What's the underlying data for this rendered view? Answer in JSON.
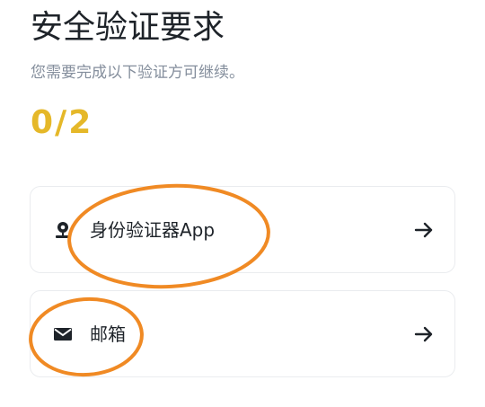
{
  "header": {
    "title": "安全验证要求",
    "subtitle": "您需要完成以下验证方可继续。"
  },
  "progress": {
    "text": "0/2",
    "completed": 0,
    "total": 2,
    "color": "#e5b829"
  },
  "methods": [
    {
      "label": "身份验证器App",
      "icon": "authenticator-icon",
      "arrow": "arrow-right-icon"
    },
    {
      "label": "邮箱",
      "icon": "mail-icon",
      "arrow": "arrow-right-icon"
    }
  ],
  "annotation": {
    "color": "#f08a24",
    "marks": [
      "circle around 身份验证器App",
      "circle around 邮箱"
    ]
  }
}
